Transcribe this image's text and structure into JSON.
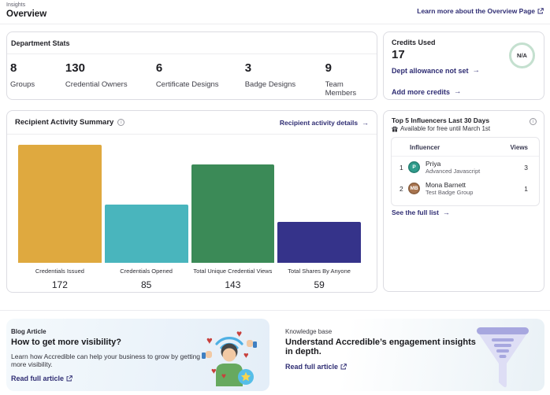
{
  "page": {
    "breadcrumb": "Insights",
    "title": "Overview",
    "learn_more_link": "Learn more about the Overview Page"
  },
  "department_stats": {
    "title": "Department Stats",
    "stats": [
      {
        "value": "8",
        "label": "Groups"
      },
      {
        "value": "130",
        "label": "Credential Owners"
      },
      {
        "value": "6",
        "label": "Certificate Designs"
      },
      {
        "value": "3",
        "label": "Badge Designs"
      },
      {
        "value": "9",
        "label": "Team Members"
      }
    ]
  },
  "credits": {
    "title": "Credits Used",
    "value": "17",
    "allowance_link": "Dept allowance not set",
    "add_link": "Add more credits",
    "gauge_label": "N/A",
    "gauge_ring_color": "#c4e0cf"
  },
  "activity": {
    "title": "Recipient Activity Summary",
    "details_link": "Recipient activity details"
  },
  "chart_data": {
    "type": "bar",
    "categories": [
      "Credentials Issued",
      "Credentials Opened",
      "Total Unique Credential Views",
      "Total Shares By Anyone"
    ],
    "values": [
      172,
      85,
      143,
      59
    ],
    "colors": [
      "#DFA93F",
      "#49B5BD",
      "#3B8A57",
      "#35338A"
    ],
    "title": "Recipient Activity Summary",
    "xlabel": "",
    "ylabel": "",
    "ylim": [
      0,
      175
    ],
    "grid": false,
    "legend": false
  },
  "influencers": {
    "title": "Top 5 Influencers Last 30 Days",
    "subtitle": "Available for free until March 1st",
    "columns": {
      "influencer": "Influencer",
      "views": "Views"
    },
    "rows": [
      {
        "rank": "1",
        "initials": "P",
        "name": "Priya",
        "group": "Advanced Javascript",
        "views": "3",
        "avatar_color": "#2F9C8C"
      },
      {
        "rank": "2",
        "initials": "MB",
        "name": "Mona Barnett",
        "group": "Test Badge Group",
        "views": "1",
        "avatar_color": "#A8744E"
      }
    ],
    "see_full_list": "See the full list"
  },
  "blog": {
    "kicker": "Blog Article",
    "title": "How to get more visibility?",
    "body": "Learn how Accredible can help your business to grow by getting more visibility.",
    "link": "Read full article"
  },
  "knowledge": {
    "kicker": "Knowledge base",
    "title": "Understand Accredible’s engagement insights in depth.",
    "link": "Read full article"
  },
  "colors": {
    "link_indigo": "#2f2d73",
    "bar_gold": "#DFA93F",
    "bar_teal": "#49B5BD",
    "bar_green": "#3B8A57",
    "bar_indigo": "#35338A"
  }
}
